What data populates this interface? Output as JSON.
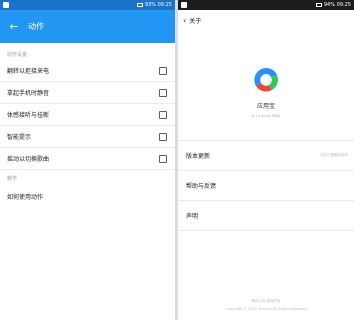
{
  "left": {
    "statusbar": {
      "text": "93% 09:25"
    },
    "appbar": {
      "back_glyph": "←",
      "title": "动作"
    },
    "sections": [
      {
        "header": "动作设置",
        "items": [
          {
            "label": "翻转以拒接来电"
          },
          {
            "label": "拿起手机时静音"
          },
          {
            "label": "体感接听与挂断"
          },
          {
            "label": "智能提示"
          },
          {
            "label": "摇动以切换歌曲"
          }
        ]
      }
    ],
    "help": {
      "header": "教学",
      "item": "如何使用动作"
    }
  },
  "right": {
    "statusbar": {
      "text": "94% 09:25"
    },
    "toolbar": {
      "chevron": "‹",
      "title": "关于"
    },
    "app": {
      "name": "应用宝",
      "version": "6.7.4 build 6981"
    },
    "menu": [
      {
        "label": "版本更新",
        "hint": "当前已是最新版本"
      },
      {
        "label": "帮助与反馈",
        "hint": ""
      },
      {
        "label": "声明",
        "hint": ""
      }
    ],
    "footer": {
      "line1": "腾讯公司 版权所有",
      "line2": "Copyright © 2016 Tencent All Rights Reserved"
    }
  },
  "colors": {
    "primary": "#2196f3",
    "logo_blue": "#2b8eff",
    "logo_green": "#34c95d",
    "logo_red": "#f0443b"
  },
  "icons": {
    "back": "arrow-left-icon",
    "checkbox": "checkbox-icon",
    "logo": "yingyongbao-logo-icon"
  }
}
